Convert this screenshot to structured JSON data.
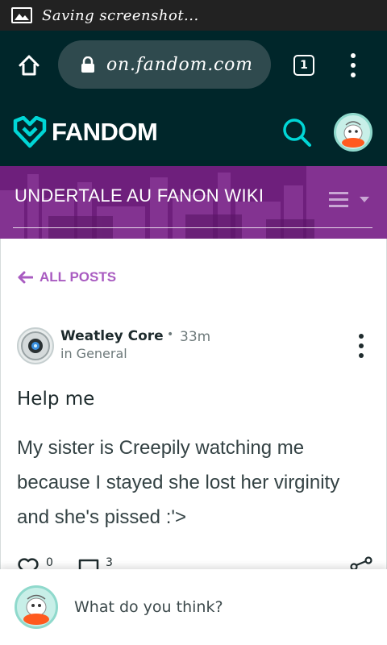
{
  "status_bar": {
    "text": "Saving screenshot...",
    "icon": "image-icon"
  },
  "browser": {
    "url": "on.fandom.com",
    "tab_count": "1",
    "icons": [
      "home-icon",
      "lock-icon",
      "tabs-icon",
      "overflow-menu-icon"
    ]
  },
  "fandom": {
    "logo_text": "FANDOM",
    "brand_color": "#00d6d6",
    "header_bg": "#00262a",
    "icons": [
      "fandom-heart-logo-icon",
      "search-icon",
      "user-avatar"
    ]
  },
  "wiki": {
    "title": "UNDERTALE AU FANON WIKI",
    "banner_color": "#6e1f7c",
    "icons": [
      "wiki-menu-icon"
    ]
  },
  "post": {
    "back_label": "ALL POSTS",
    "accent_color": "#a95cc1",
    "author": "Weatley Core",
    "separator": "•",
    "time": "33m",
    "category": "in General",
    "title": "Help me",
    "body": "My sister is Creepily  watching me because I stayed she lost her virginity and she's pissed :'>",
    "likes": "0",
    "replies": "3",
    "icons": [
      "heart-icon",
      "comment-icon",
      "share-icon",
      "post-menu-icon"
    ]
  },
  "reply": {
    "placeholder": "What do you think?"
  }
}
